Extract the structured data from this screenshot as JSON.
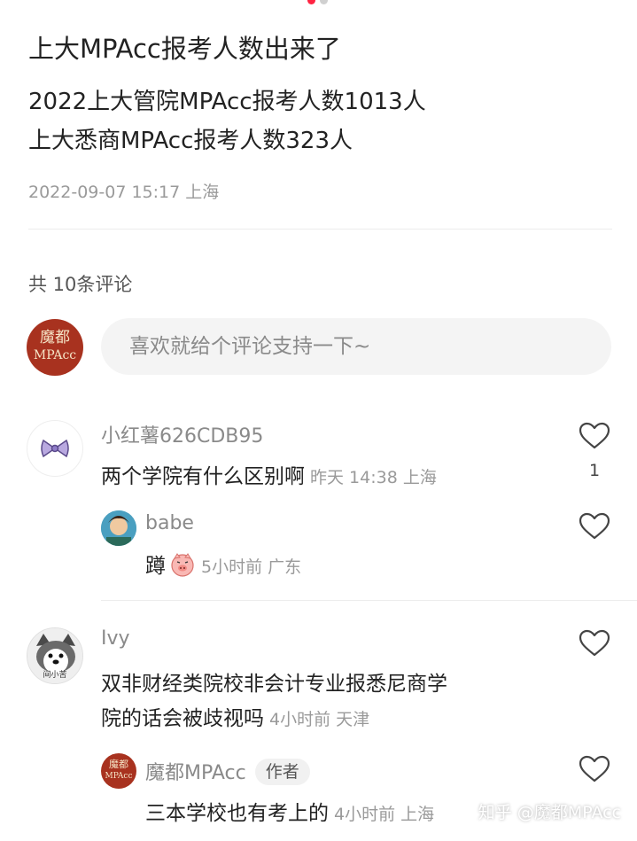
{
  "post": {
    "title": "上大MPAcc报考人数出来了",
    "body_line1": "2022上大管院MPAcc报考人数1013人",
    "body_line2": "上大悉商MPAcc报考人数323人",
    "date": "2022-09-07 15:17 上海"
  },
  "comments_section": {
    "count_label": "共 10条评论",
    "input_placeholder": "喜欢就给个评论支持一下~",
    "my_avatar_line1": "魔都",
    "my_avatar_line2": "MPAcc"
  },
  "comments": [
    {
      "username": "小红薯626CDB95",
      "text": "两个学院有什么区别啊",
      "meta": "昨天 14:38 上海",
      "likes": "1",
      "replies": [
        {
          "username": "babe",
          "text": "蹲",
          "meta": "5小时前 广东"
        }
      ]
    },
    {
      "username": "Ivy",
      "avatar_text": "间小苦",
      "text_line1": "双非财经类院校非会计专业报悉尼商学",
      "text_line2": "院的话会被歧视吗",
      "meta": "4小时前 天津",
      "replies": [
        {
          "username": "魔都MPAcc",
          "tag": "作者",
          "avatar_line1": "魔都",
          "avatar_line2": "MPAcc",
          "text": "三本学校也有考上的",
          "meta": "4小时前 上海"
        }
      ]
    }
  ],
  "watermark": "知乎 @魔都MPAcc",
  "colors": {
    "brand": "#ff2442",
    "avatar_red": "#a8321f",
    "muted": "#9a9a9a"
  },
  "icons": [
    "heart-outline-icon",
    "bow-icon",
    "pig-emoji-icon"
  ]
}
